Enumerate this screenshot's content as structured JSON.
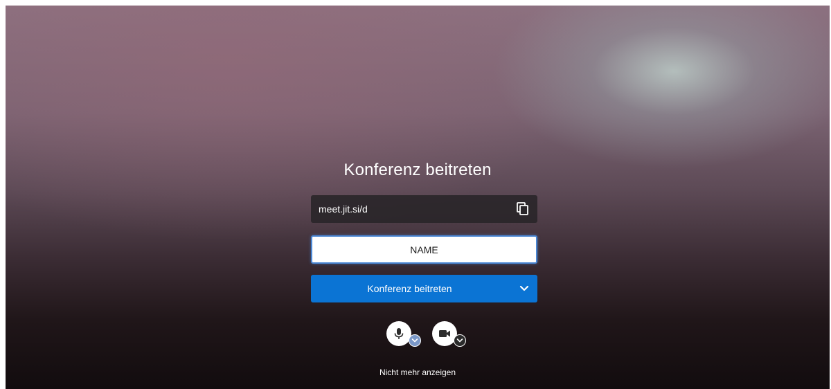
{
  "prejoin": {
    "title": "Konferenz beitreten",
    "meeting_url": "meet.jit.si/d",
    "name_input_value": "NAME",
    "join_button_label": "Konferenz beitreten",
    "dont_show_again_label": "Nicht mehr anzeigen"
  },
  "icons": {
    "copy": "copy-icon",
    "join_options": "chevron-down-icon",
    "microphone": "microphone-icon",
    "camera": "camera-icon",
    "audio_settings": "chevron-down-icon",
    "video_settings": "chevron-down-icon"
  },
  "colors": {
    "primary_button": "#0b74d4",
    "url_box": "#282428",
    "input_border": "#4a87d4"
  }
}
